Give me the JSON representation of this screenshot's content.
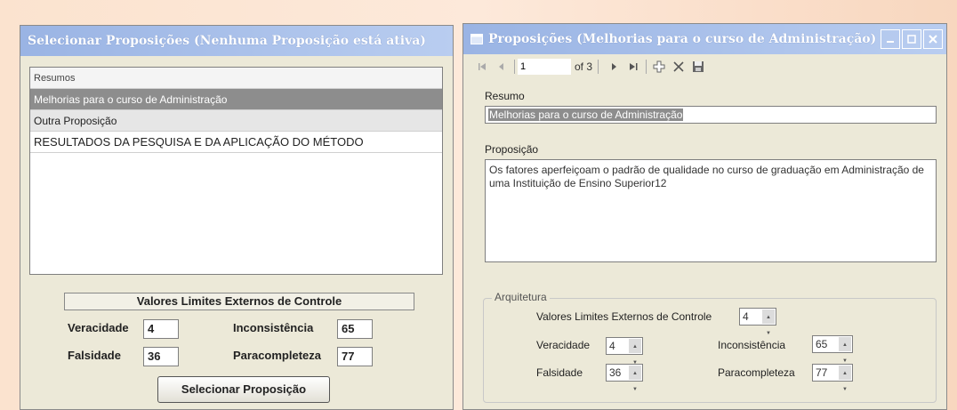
{
  "left_window": {
    "title": "Selecionar Proposições (Nenhuma Proposição está ativa)",
    "list": {
      "header": "Resumos",
      "items": [
        "Melhorias para o curso de Administração",
        "Outra Proposição",
        "RESULTADOS DA PESQUISA E DA APLICAÇÃO DO MÉTODO"
      ]
    },
    "group_title": "Valores Limites Externos de Controle",
    "fields": {
      "veracidade_label": "Veracidade",
      "veracidade_value": "4",
      "inconsistencia_label": "Inconsistência",
      "inconsistencia_value": "65",
      "falsidade_label": "Falsidade",
      "falsidade_value": "36",
      "paracompleteza_label": "Paracompleteza",
      "paracompleteza_value": "77"
    },
    "select_button": "Selecionar Proposição"
  },
  "right_window": {
    "title": "Proposições (Melhorias para o curso de Administração)",
    "toolbar": {
      "position": "1",
      "of_label": "of 3"
    },
    "resumo_label": "Resumo",
    "resumo_value": "Melhorias para o curso de Administração",
    "proposicao_label": "Proposição",
    "proposicao_value": "Os fatores aperfeiçoam o padrão de qualidade no curso de graduação em Administração de uma Instituição de Ensino Superior12",
    "arquitetura": {
      "group_label": "Arquitetura",
      "vlec_label": "Valores Limites Externos de Controle",
      "vlec_value": "4",
      "veracidade_label": "Veracidade",
      "veracidade_value": "4",
      "inconsistencia_label": "Inconsistência",
      "inconsistencia_value": "65",
      "falsidade_label": "Falsidade",
      "falsidade_value": "36",
      "paracompleteza_label": "Paracompleteza",
      "paracompleteza_value": "77"
    }
  },
  "icons": [
    "first-record-icon",
    "prev-record-icon",
    "next-record-icon",
    "last-record-icon",
    "add-icon",
    "delete-icon",
    "save-icon",
    "minimize-icon",
    "maximize-icon",
    "close-icon",
    "window-icon"
  ]
}
